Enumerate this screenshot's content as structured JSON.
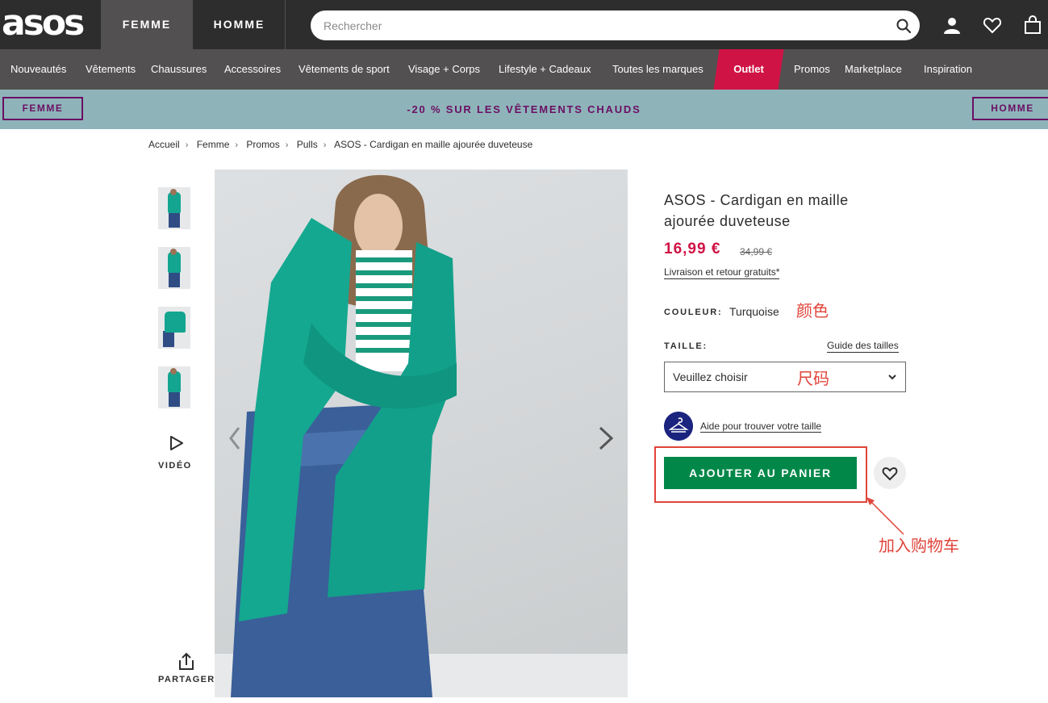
{
  "header": {
    "logo": "asos",
    "tabs": [
      "FEMME",
      "HOMME"
    ],
    "search_placeholder": "Rechercher"
  },
  "categories": [
    "Nouveautés",
    "Vêtements",
    "Chaussures",
    "Accessoires",
    "Vêtements de sport",
    "Visage + Corps",
    "Lifestyle + Cadeaux",
    "Toutes les marques",
    "Outlet",
    "Promos",
    "Marketplace",
    "Inspiration"
  ],
  "promo": {
    "left_button": "FEMME",
    "text": "-20 % SUR LES VÊTEMENTS CHAUDS",
    "right_button": "HOMME"
  },
  "breadcrumb": [
    "Accueil",
    "Femme",
    "Promos",
    "Pulls",
    "ASOS - Cardigan en maille ajourée duveteuse"
  ],
  "gallery": {
    "video_label": "VIDÉO",
    "share_label": "PARTAGER"
  },
  "product": {
    "title": "ASOS - Cardigan en maille ajourée duveteuse",
    "price": "16,99 €",
    "old_price": "34,99 €",
    "delivery": "Livraison et retour gratuits*",
    "color_label": "COULEUR:",
    "color_value": "Turquoise",
    "size_label": "TAILLE:",
    "size_guide": "Guide des tailles",
    "size_select": "Veuillez choisir",
    "fit_help": "Aide pour trouver votre taille",
    "add_to_cart": "AJOUTER AU PANIER"
  },
  "annotations": {
    "color": "颜色",
    "size": "尺码",
    "cart": "加入购物车"
  },
  "colors": {
    "dark": "#2d2d2d",
    "nav": "#525050",
    "outlet": "#d01345",
    "promo_bg": "#8eb4ba",
    "promo_text": "#6b0f63",
    "price": "#d01345",
    "add_button": "#018849",
    "annotation": "#e0443a"
  }
}
